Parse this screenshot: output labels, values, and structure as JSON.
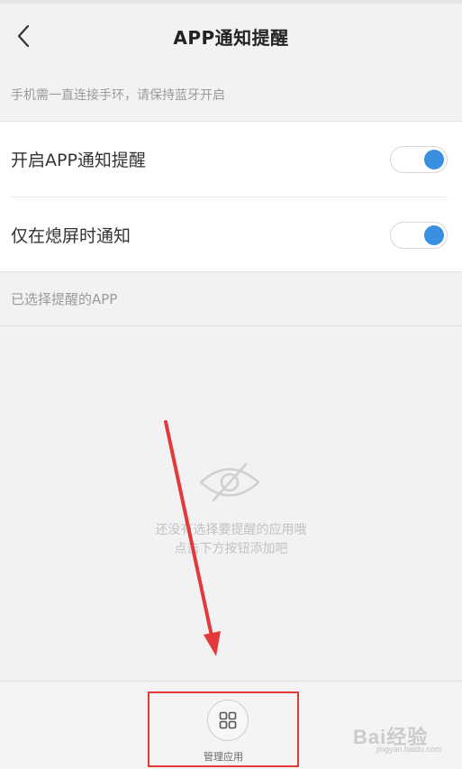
{
  "header": {
    "title": "APP通知提醒",
    "back_icon": "chevron-left-icon"
  },
  "hint": "手机需一直连接手环，请保持蓝牙开启",
  "settings": [
    {
      "label": "开启APP通知提醒",
      "enabled": true
    },
    {
      "label": "仅在熄屏时通知",
      "enabled": true
    }
  ],
  "section_title": "已选择提醒的APP",
  "empty_state": {
    "icon": "eye-slash-icon",
    "line1": "还没有选择要提醒的应用哦",
    "line2": "点击下方按钮添加吧"
  },
  "footer": {
    "manage_label": "管理应用",
    "manage_icon": "grid-icon"
  },
  "watermark": {
    "logo": "Bai经验",
    "site": "jingyan.baidu.com"
  },
  "colors": {
    "accent": "#3a8fe0",
    "annotation": "#e23a3a"
  }
}
